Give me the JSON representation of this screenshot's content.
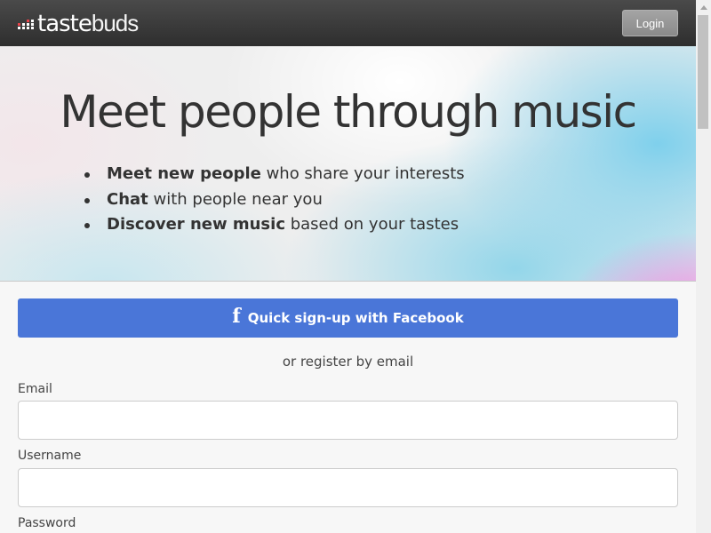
{
  "header": {
    "logo_part1": "taste",
    "logo_part2": "buds",
    "login_label": "Login"
  },
  "hero": {
    "title": "Meet people through music",
    "features": [
      {
        "bold": "Meet new people",
        "rest": " who share your interests"
      },
      {
        "bold": "Chat",
        "rest": " with people near you"
      },
      {
        "bold": "Discover new music",
        "rest": " based on your tastes"
      }
    ]
  },
  "signup": {
    "facebook_icon": "f",
    "facebook_label": "Quick sign-up with Facebook",
    "or_text": "or register by email",
    "email_label": "Email",
    "email_value": "",
    "username_label": "Username",
    "username_value": "",
    "password_label": "Password"
  },
  "colors": {
    "topbar": "#2e2e2e",
    "facebook": "#4a76d8",
    "logo_accent": "#e8434a"
  },
  "icons": {
    "logo": "equalizer-bars-icon",
    "facebook": "facebook-f-icon"
  }
}
